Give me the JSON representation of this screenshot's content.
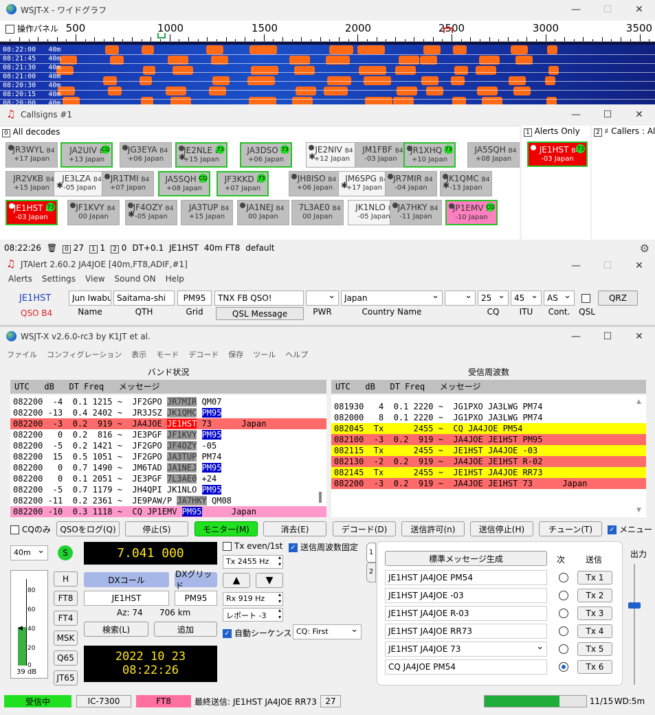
{
  "wide": {
    "title": "WSJT-X - ワイドグラフ",
    "panel_chk": "操作パネル",
    "scale": [
      "500",
      "1000",
      "1500",
      "2000",
      "2500",
      "3000",
      "3500"
    ],
    "rows": [
      {
        "t": "08:22:00",
        "b": "40m"
      },
      {
        "t": "08:21:45",
        "b": "40m"
      },
      {
        "t": "08:21:30",
        "b": "40m"
      },
      {
        "t": "08:21:00",
        "b": "40m"
      },
      {
        "t": "08:20:30",
        "b": "40m"
      },
      {
        "t": "08:20:15",
        "b": "40m"
      },
      {
        "t": "08:20:00",
        "b": "40m"
      }
    ]
  },
  "callsigns": {
    "title": "Callsigns #1",
    "tab0": "All decodes",
    "tab1": "Alerts Only",
    "tab2": "Callers : Ale",
    "grid": [
      {
        "c": "JR3WYL",
        "s": "+17 Japan",
        "dot": true,
        "ast": false,
        "g": false,
        "b73": false,
        "cq": false,
        "style": ""
      },
      {
        "c": "JA2UIV",
        "s": "+13 Japan",
        "dot": false,
        "ast": false,
        "g": true,
        "b73": false,
        "cq": true,
        "style": ""
      },
      {
        "c": "JG3EYA",
        "s": "+06 Japan",
        "dot": true,
        "ast": false,
        "g": false,
        "b73": false,
        "cq": false,
        "style": ""
      },
      {
        "c": "JE2NLE",
        "s": "+15 Japan",
        "dot": true,
        "ast": true,
        "g": true,
        "b73": true,
        "cq": false,
        "style": ""
      },
      {
        "c": "JA3DSO",
        "s": "+06 Japan",
        "dot": false,
        "ast": false,
        "g": true,
        "b73": true,
        "cq": false,
        "style": ""
      },
      {
        "c": "JE2NIV",
        "s": "+12 Japan",
        "dot": true,
        "ast": true,
        "g": false,
        "b73": false,
        "cq": false,
        "style": "white"
      },
      {
        "c": "JM1FBF",
        "s": "-03 Japan",
        "dot": false,
        "ast": false,
        "g": false,
        "b73": false,
        "cq": false,
        "style": ""
      },
      {
        "c": "JR1XHQ",
        "s": "+10 Japan",
        "dot": true,
        "ast": false,
        "g": true,
        "b73": true,
        "cq": false,
        "style": ""
      },
      {
        "c": "JA5SQH",
        "s": "+08 Japan",
        "dot": false,
        "ast": false,
        "g": false,
        "b73": false,
        "cq": false,
        "style": ""
      },
      {
        "c": "JR2VKB",
        "s": "+15 Japan",
        "dot": false,
        "ast": false,
        "g": false,
        "b73": false,
        "cq": false,
        "style": ""
      },
      {
        "c": "JE3LZA",
        "s": "-05 Japan",
        "dot": false,
        "ast": true,
        "g": false,
        "b73": false,
        "cq": false,
        "style": "white"
      },
      {
        "c": "JR1TMI",
        "s": "+07 Japan",
        "dot": true,
        "ast": false,
        "g": false,
        "b73": false,
        "cq": false,
        "style": ""
      },
      {
        "c": "JA5SQH",
        "s": "+08 Japan",
        "dot": false,
        "ast": false,
        "g": true,
        "b73": false,
        "cq": true,
        "style": ""
      },
      {
        "c": "JF3KKD",
        "s": "+07 Japan",
        "dot": false,
        "ast": false,
        "g": true,
        "b73": true,
        "cq": false,
        "style": ""
      },
      {
        "c": "JH8ISO",
        "s": "+06 Japan",
        "dot": true,
        "ast": false,
        "g": false,
        "b73": false,
        "cq": false,
        "style": ""
      },
      {
        "c": "JM6SPG",
        "s": "+17 Japan",
        "dot": false,
        "ast": true,
        "g": false,
        "b73": false,
        "cq": false,
        "style": "white"
      },
      {
        "c": "JR7MIR",
        "s": "-04 Japan",
        "dot": true,
        "ast": false,
        "g": false,
        "b73": false,
        "cq": false,
        "style": ""
      },
      {
        "c": "JK1QMC",
        "s": "-13 Japan",
        "dot": true,
        "ast": true,
        "g": false,
        "b73": false,
        "cq": false,
        "style": ""
      },
      {
        "c": "JE1HST",
        "s": "-03 Japan",
        "dot": true,
        "ast": false,
        "g": true,
        "b73": true,
        "cq": false,
        "style": "red"
      },
      {
        "c": "JF1KVY",
        "s": "00 Japan",
        "dot": true,
        "ast": false,
        "g": false,
        "b73": false,
        "cq": false,
        "style": ""
      },
      {
        "c": "JF4OZY",
        "s": "-05 Japan",
        "dot": true,
        "ast": true,
        "g": false,
        "b73": false,
        "cq": false,
        "style": ""
      },
      {
        "c": "JA3TUP",
        "s": "+15 Japan",
        "dot": false,
        "ast": false,
        "g": false,
        "b73": false,
        "cq": false,
        "style": ""
      },
      {
        "c": "JA1NEJ",
        "s": "00 Japan",
        "dot": true,
        "ast": false,
        "g": false,
        "b73": false,
        "cq": false,
        "style": ""
      },
      {
        "c": "7L3AE0",
        "s": "00 Japan",
        "dot": false,
        "ast": false,
        "g": false,
        "b73": false,
        "cq": false,
        "style": ""
      },
      {
        "c": "JK1NLO",
        "s": "-05 Japan",
        "dot": false,
        "ast": false,
        "g": false,
        "b73": false,
        "cq": false,
        "style": "white"
      },
      {
        "c": "JA7HKY",
        "s": "-11 Japan",
        "dot": true,
        "ast": false,
        "g": false,
        "b73": false,
        "cq": false,
        "style": ""
      },
      {
        "c": "JP1EMV",
        "s": "-10 Japan",
        "dot": true,
        "ast": false,
        "g": true,
        "b73": false,
        "cq": true,
        "style": "pink"
      }
    ],
    "alert": {
      "c": "JE1HST",
      "s": "-03 Japan"
    },
    "status": {
      "time": "08:22:26",
      "n0": "27",
      "n1": "1",
      "n2": "0",
      "dt": "DT+0.1",
      "call": "JE1HST",
      "band": "40m FT8",
      "profile": "default"
    },
    "badge_suffix": "B4",
    "badge_73": "73",
    "badge_cq": "CQ"
  },
  "jtalert": {
    "title": "JTAlert 2.60.2 JA4JOE [40m,FT8,ADIF,#1]",
    "menu": [
      "Alerts",
      "Settings",
      "View",
      "Sound ON",
      "Help"
    ],
    "call": "JE1HST",
    "qso": "QSO B4",
    "name": "Jun Iwabu",
    "qth": "Saitama-shi",
    "grid": "PM95",
    "msg": "TNX FB QSO!",
    "country": "Japan",
    "cq": "25",
    "itu": "45",
    "cont": "AS",
    "qrz": "QRZ",
    "labels": {
      "name": "Name",
      "qth": "QTH",
      "grid": "Grid",
      "qslmsg": "QSL Message",
      "pwr": "PWR",
      "country": "Country Name",
      "cq": "CQ",
      "itu": "ITU",
      "cont": "Cont.",
      "qsl": "QSL"
    }
  },
  "wsjtx": {
    "title": "WSJT-X   v2.6.0-rc3   by K1JT et al.",
    "menu": [
      "ファイル",
      "コンフィグレーション",
      "表示",
      "モード",
      "デコード",
      "保存",
      "ツール",
      "ヘルプ"
    ],
    "band_title": "バンド状況",
    "rx_title": "受信周波数",
    "hdr": "UTC   dB   DT Freq   メッセージ",
    "band_rows": [
      {
        "p": "082200  -4  0.1 1215 ~  JF2GPO ",
        "h": "JR7MIR",
        "hc": "hlg",
        "e": " QM07",
        "r": ""
      },
      {
        "p": "082200 -13  0.4 2402 ~  JR3JSZ ",
        "h": "JK1QMC",
        "hc": "hlg",
        "e": " ",
        "h2": "PM95",
        "r": ""
      },
      {
        "p": "082200  -3  0.2  919 ~  JA4JOE ",
        "h": "JE1HST",
        "hc": "hlr",
        "e": " 73      Japan",
        "r": "rowred"
      },
      {
        "p": "082200   0  0.2  816 ~  JE3PGF ",
        "h": "JF1KVY",
        "hc": "hlg",
        "e": " ",
        "h2": "PM95",
        "r": ""
      },
      {
        "p": "082200  -5  0.2 1421 ~  JF2GPO ",
        "h": "JF4OZY",
        "hc": "hlg",
        "e": " -05",
        "r": ""
      },
      {
        "p": "082200  15  0.5 1051 ~  JF2GPO ",
        "h": "JA3TUP",
        "hc": "hlg",
        "e": " PM74",
        "r": ""
      },
      {
        "p": "082200   0  0.7 1490 ~  JM6TAD ",
        "h": "JA1NEJ",
        "hc": "hlg",
        "e": " ",
        "h2": "PM95",
        "r": ""
      },
      {
        "p": "082200   0  0.1 2051 ~  JE3PGF ",
        "h": "7L3AE0",
        "hc": "hlg",
        "e": " +24",
        "r": ""
      },
      {
        "p": "082200  -5  0.7 1179 ~  JH4QPI ",
        "h": "JK1NLO",
        "hc": "",
        "e": " ",
        "h2": "PM95",
        "r": ""
      },
      {
        "p": "082200 -11  0.2 2361 ~  JE9PAW/P ",
        "h": "JA7HKY",
        "hc": "hlg",
        "e": " QM08",
        "r": ""
      },
      {
        "p": "082200 -10  0.3 1118 ~  CQ JP1EMV ",
        "h": "PM95",
        "hc": "hl",
        "e": "      Japan",
        "r": "rowpink"
      }
    ],
    "rx_rows": [
      {
        "t": "081930   4  0.1 2220 ~  JG1PXO JA3LWG PM74",
        "r": ""
      },
      {
        "t": "082000   8  0.1 2220 ~  JG1PXO JA3LWG PM74",
        "r": ""
      },
      {
        "t": "082045  Tx      2455 ~  CQ JA4JOE PM54",
        "r": "rowyel"
      },
      {
        "t": "082100  -3  0.2  919 ~  JA4JOE JE1HST PM95",
        "r": "rowred"
      },
      {
        "t": "082115  Tx      2455 ~  JE1HST JA4JOE -03",
        "r": "rowyel"
      },
      {
        "t": "082130  -2  0.2  919 ~  JA4JOE JE1HST R-02",
        "r": "rowred"
      },
      {
        "t": "082145  Tx      2455 ~  JE1HST JA4JOE RR73",
        "r": "rowyel"
      },
      {
        "t": "082200  -3  0.2  919 ~  JA4JOE JE1HST 73      Japan",
        "r": "rowred"
      }
    ],
    "cqonly": "CQのみ",
    "b_log": "QSOをログ(Q)",
    "b_stop": "停止(S)",
    "b_monitor": "モニター(M)",
    "b_erase": "消去(E)",
    "b_decode": "デコード(D)",
    "b_enable": "送信許可(n)",
    "b_halt": "送信停止(H)",
    "b_tune": "チューン(T)",
    "menus": "メニュー",
    "band": "40m",
    "freq": "7.041 000",
    "tx_even": "Tx even/1st",
    "tx_fix": "送信周波数固定",
    "tx_hz": "Tx  2455  Hz",
    "rx_hz": "Rx  919  Hz",
    "report": "レポート -3",
    "auto_seq": "自動シーケンス",
    "cq_first": "CQ: First",
    "dx_call_lbl": "DXコール",
    "dx_grid_lbl": "DXグリッド",
    "dx_call": "JE1HST",
    "dx_grid": "PM95",
    "az": "Az: 74",
    "dist": "706 km",
    "lookup": "検索(L)",
    "add": "追加",
    "modes": [
      "H",
      "FT8",
      "FT4",
      "MSK",
      "Q65",
      "JT65"
    ],
    "s": "S",
    "meter": [
      "80",
      "60",
      "40",
      "20",
      "0"
    ],
    "db": "39 dB",
    "date": "2022 10 23",
    "time": "08:22:26",
    "gen": "標準メッセージ生成",
    "next": "次",
    "send": "送信",
    "power": "出力",
    "tx_msgs": [
      "JE1HST JA4JOE PM54",
      "JE1HST JA4JOE -03",
      "JE1HST JA4JOE R-03",
      "JE1HST JA4JOE RR73",
      "JE1HST JA4JOE 73",
      "CQ JA4JOE PM54"
    ],
    "tx_btns": [
      "Tx 1",
      "Tx 2",
      "Tx 3",
      "Tx 4",
      "Tx 5",
      "Tx 6"
    ],
    "tab1": "1",
    "tab2": "2",
    "status": {
      "rx": "受信中",
      "rig": "IC-7300",
      "mode": "FT8",
      "last": "最終送信: JE1HST JA4JOE RR73",
      "n": "27",
      "prog": "11/15",
      "wd": "WD:5m"
    }
  },
  "colors": {
    "green": "#27c227",
    "red": "#ee0000",
    "yellow": "#ffff00",
    "pink": "#ff99cc"
  }
}
